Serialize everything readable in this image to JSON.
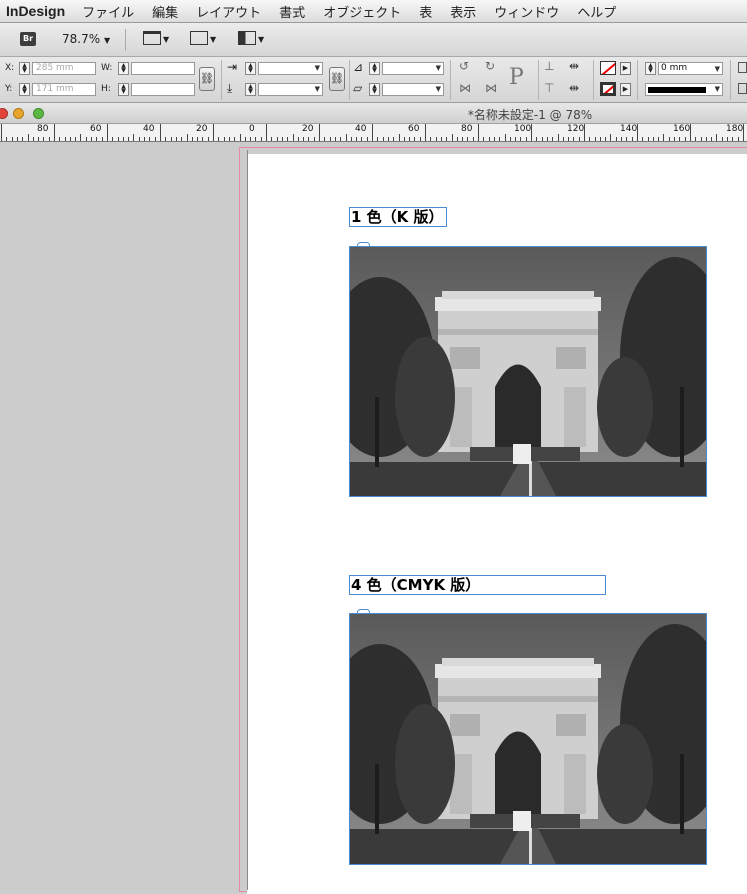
{
  "app": {
    "name": "InDesign"
  },
  "menu": [
    "ファイル",
    "編集",
    "レイアウト",
    "書式",
    "オブジェクト",
    "表",
    "表示",
    "ウィンドウ",
    "ヘルプ"
  ],
  "toolbar": {
    "bridge_label": "Br",
    "zoom": "78.7%"
  },
  "control": {
    "x_label": "X:",
    "y_label": "Y:",
    "w_label": "W:",
    "h_label": "H:",
    "x_value": "285 mm",
    "y_value": "171 mm",
    "w_value": "",
    "h_value": "",
    "stroke_weight": "0 mm"
  },
  "document": {
    "title": "*名称未設定-1 @ 78%"
  },
  "ruler": {
    "labels": [
      "80",
      "60",
      "40",
      "20",
      "0",
      "20",
      "40",
      "60",
      "80",
      "100",
      "120",
      "140",
      "160",
      "180"
    ]
  },
  "page": {
    "heading1": "1 色（K 版）",
    "heading2": "4 色（CMYK 版）",
    "photo_subject": "arc-de-triomphe-grayscale-photo"
  },
  "colors": {
    "frame_blue": "#4a8ccf",
    "bleed_pink": "#e58aa5",
    "close": "#e0443a",
    "minimize": "#e8a52b",
    "zoom": "#5cb843"
  }
}
